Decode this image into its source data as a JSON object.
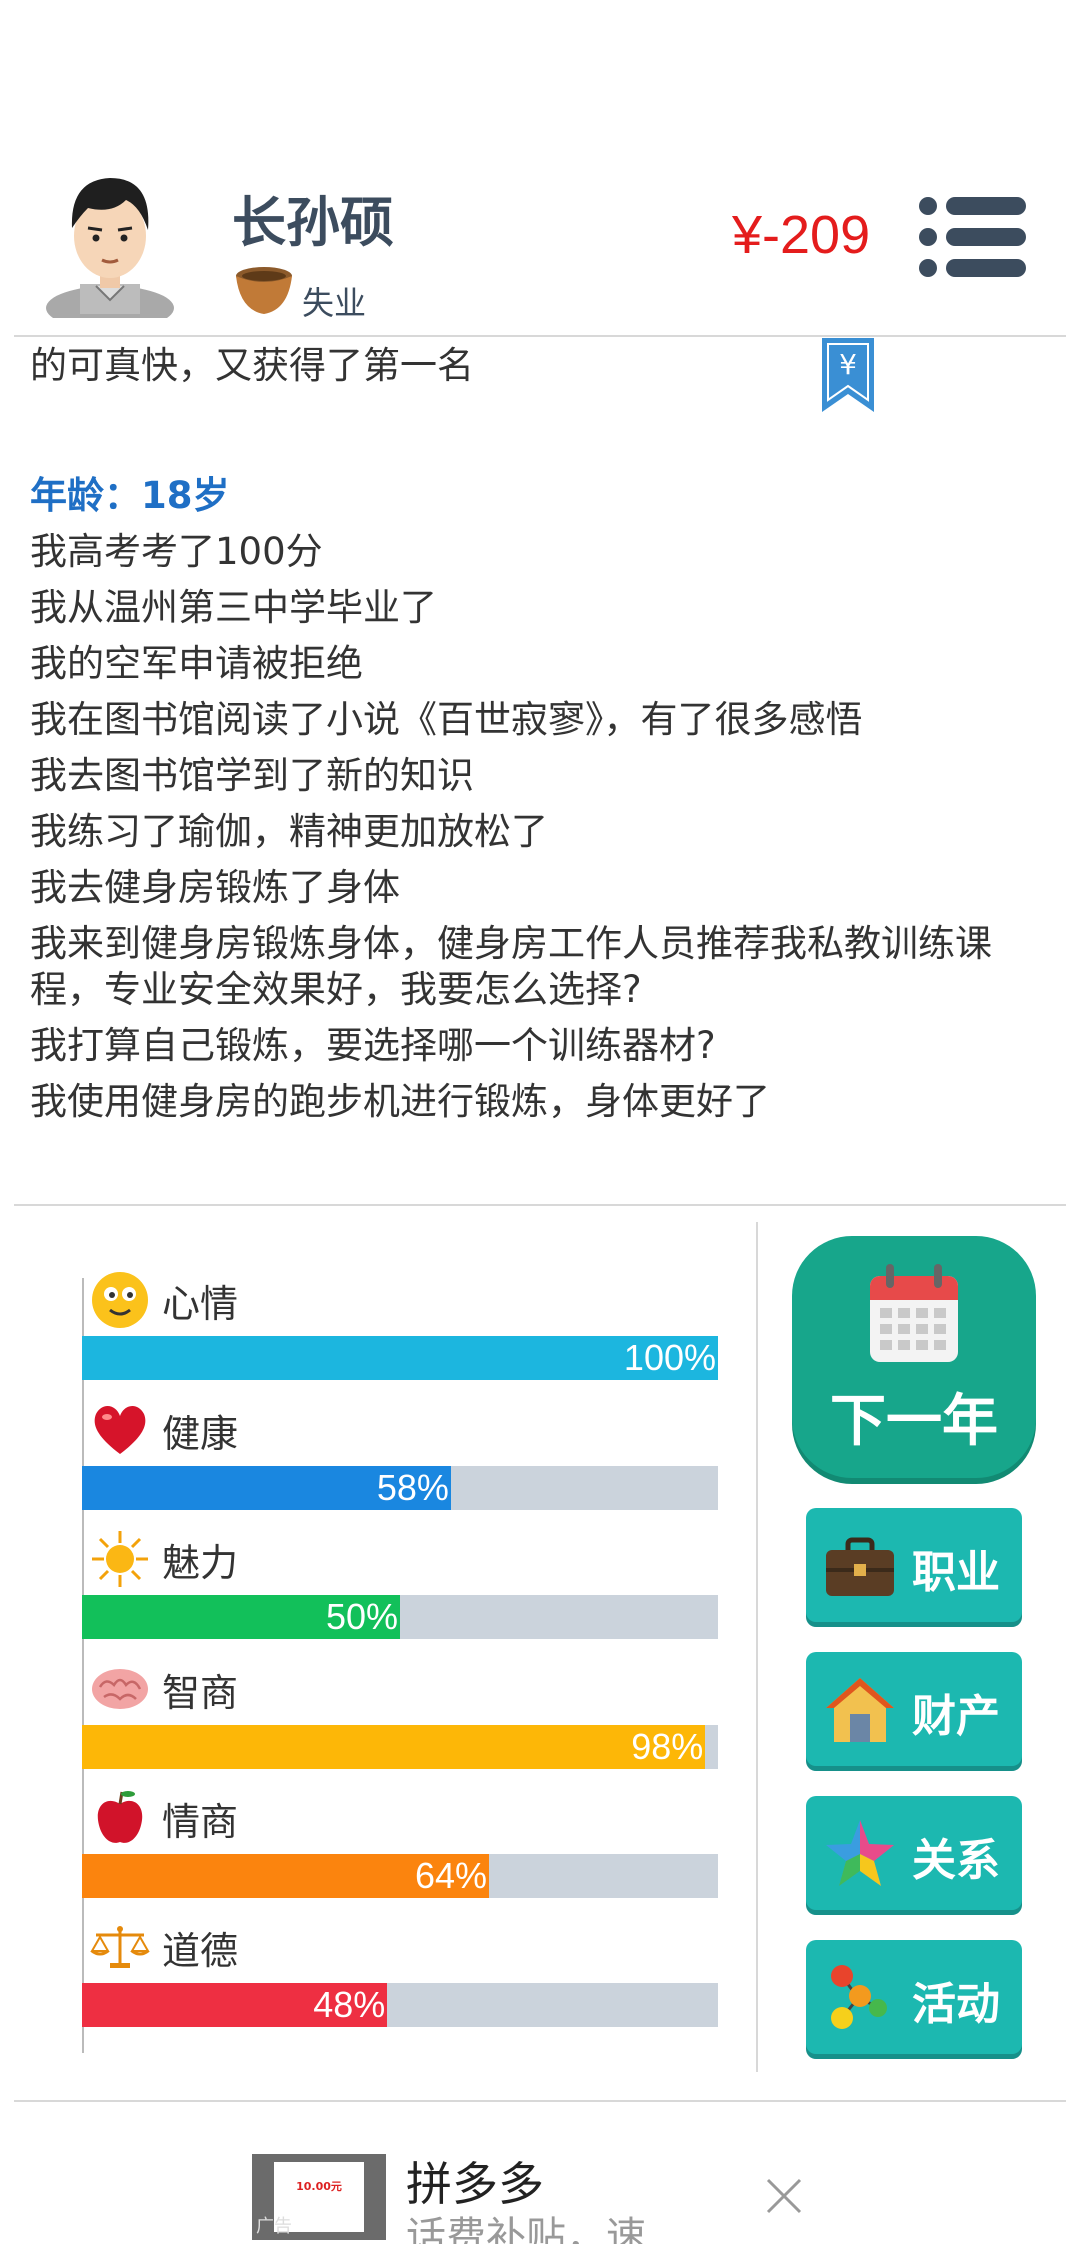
{
  "header": {
    "name": "长孙硕",
    "status": "失业",
    "money": "¥-209"
  },
  "log": {
    "first_line": "的可真快，又获得了第一名",
    "age_label": "年龄：18岁",
    "events": [
      "我高考考了100分",
      "我从温州第三中学毕业了",
      "我的空军申请被拒绝",
      "我在图书馆阅读了小说《百世寂寥》，有了很多感悟",
      "我去图书馆学到了新的知识",
      "我练习了瑜伽，精神更加放松了",
      "我去健身房锻炼了身体",
      "我来到健身房锻炼身体，健身房工作人员推荐我私教训练课程，专业安全效果好，我要怎么选择?",
      "我打算自己锻炼，要选择哪一个训练器材?",
      "我使用健身房的跑步机进行锻炼，身体更好了"
    ]
  },
  "stats": [
    {
      "label": "心情",
      "value": 100,
      "display": "100%",
      "color": "#1cb6df",
      "icon": "smiley-icon"
    },
    {
      "label": "健康",
      "value": 58,
      "display": "58%",
      "color": "#1a87e0",
      "icon": "heart-icon"
    },
    {
      "label": "魅力",
      "value": 50,
      "display": "50%",
      "color": "#12c05a",
      "icon": "sun-icon"
    },
    {
      "label": "智商",
      "value": 98,
      "display": "98%",
      "color": "#fdb707",
      "icon": "brain-icon"
    },
    {
      "label": "情商",
      "value": 64,
      "display": "64%",
      "color": "#fb840e",
      "icon": "apple-icon"
    },
    {
      "label": "道德",
      "value": 48,
      "display": "48%",
      "color": "#ee2f42",
      "icon": "scales-icon"
    }
  ],
  "buttons": {
    "next_year": "下一年",
    "career": "职业",
    "property": "财产",
    "relations": "关系",
    "activity": "活动"
  },
  "ad": {
    "thumb_text": "10.00元",
    "tag": "广告",
    "title": "拼多多",
    "subtitle": "话费补贴，速..."
  }
}
